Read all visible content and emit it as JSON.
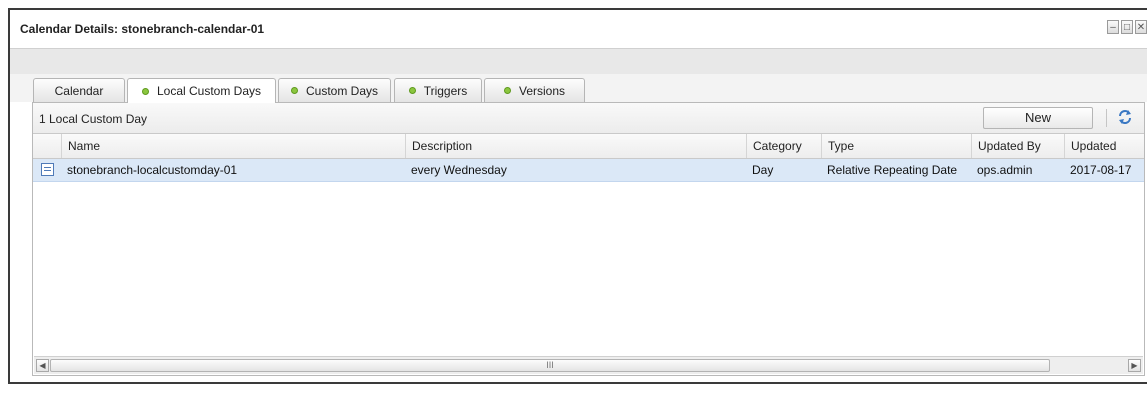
{
  "window": {
    "title": "Calendar Details: stonebranch-calendar-01",
    "controls": [
      "–",
      "□",
      "✕"
    ]
  },
  "tabs": [
    {
      "label": "Calendar",
      "status_dot": false
    },
    {
      "label": "Local Custom Days",
      "status_dot": true
    },
    {
      "label": "Custom Days",
      "status_dot": true
    },
    {
      "label": "Triggers",
      "status_dot": true
    },
    {
      "label": "Versions",
      "status_dot": true
    }
  ],
  "active_tab": "Local Custom Days",
  "panel": {
    "count_label": "1 Local Custom Day",
    "new_button": "New",
    "refresh_icon": "refresh-icon"
  },
  "table": {
    "columns": [
      "Name",
      "Description",
      "Category",
      "Type",
      "Updated By",
      "Updated"
    ],
    "rows": [
      {
        "icon": "custom-day-icon",
        "name": "stonebranch-localcustomday-01",
        "description": "every Wednesday",
        "category": "Day",
        "type": "Relative Repeating Date",
        "updated_by": "ops.admin",
        "updated": "2017-08-17"
      }
    ]
  },
  "scrollbar": {
    "thumb_grip": "III"
  },
  "colors": {
    "status_dot": "#8bc63f",
    "selected_row": "#dbe8f7",
    "accent": "#4f7ab8"
  }
}
